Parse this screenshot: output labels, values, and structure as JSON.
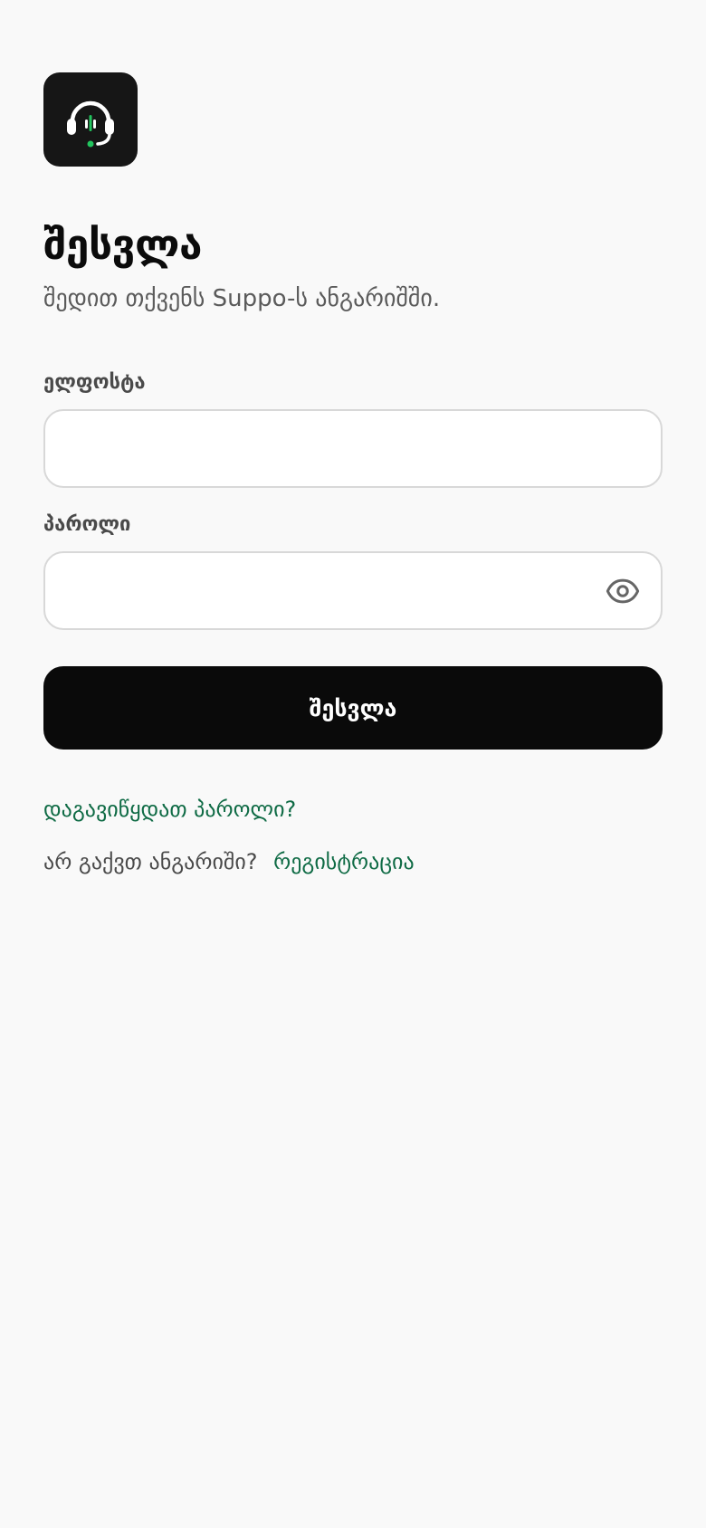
{
  "logo": {
    "icon": "headset-icon",
    "accent_color": "#22c55e",
    "background_color": "#161616"
  },
  "header": {
    "title": "შესვლა",
    "subtitle": "შედით თქვენს Suppo-ს ანგარიშში."
  },
  "form": {
    "email_label": "ელფოსტა",
    "email_value": "",
    "email_placeholder": "",
    "password_label": "პაროლი",
    "password_value": "",
    "password_placeholder": "",
    "password_toggle_icon": "eye-icon",
    "submit_label": "შესვლა"
  },
  "links": {
    "forgot_password": "დაგავიწყდათ პაროლი?",
    "no_account_text": "არ გაქვთ ანგარიში?",
    "register": "რეგისტრაცია"
  },
  "colors": {
    "background": "#f9f9f9",
    "button": "#0a0a0a",
    "link": "#0f6b45"
  }
}
